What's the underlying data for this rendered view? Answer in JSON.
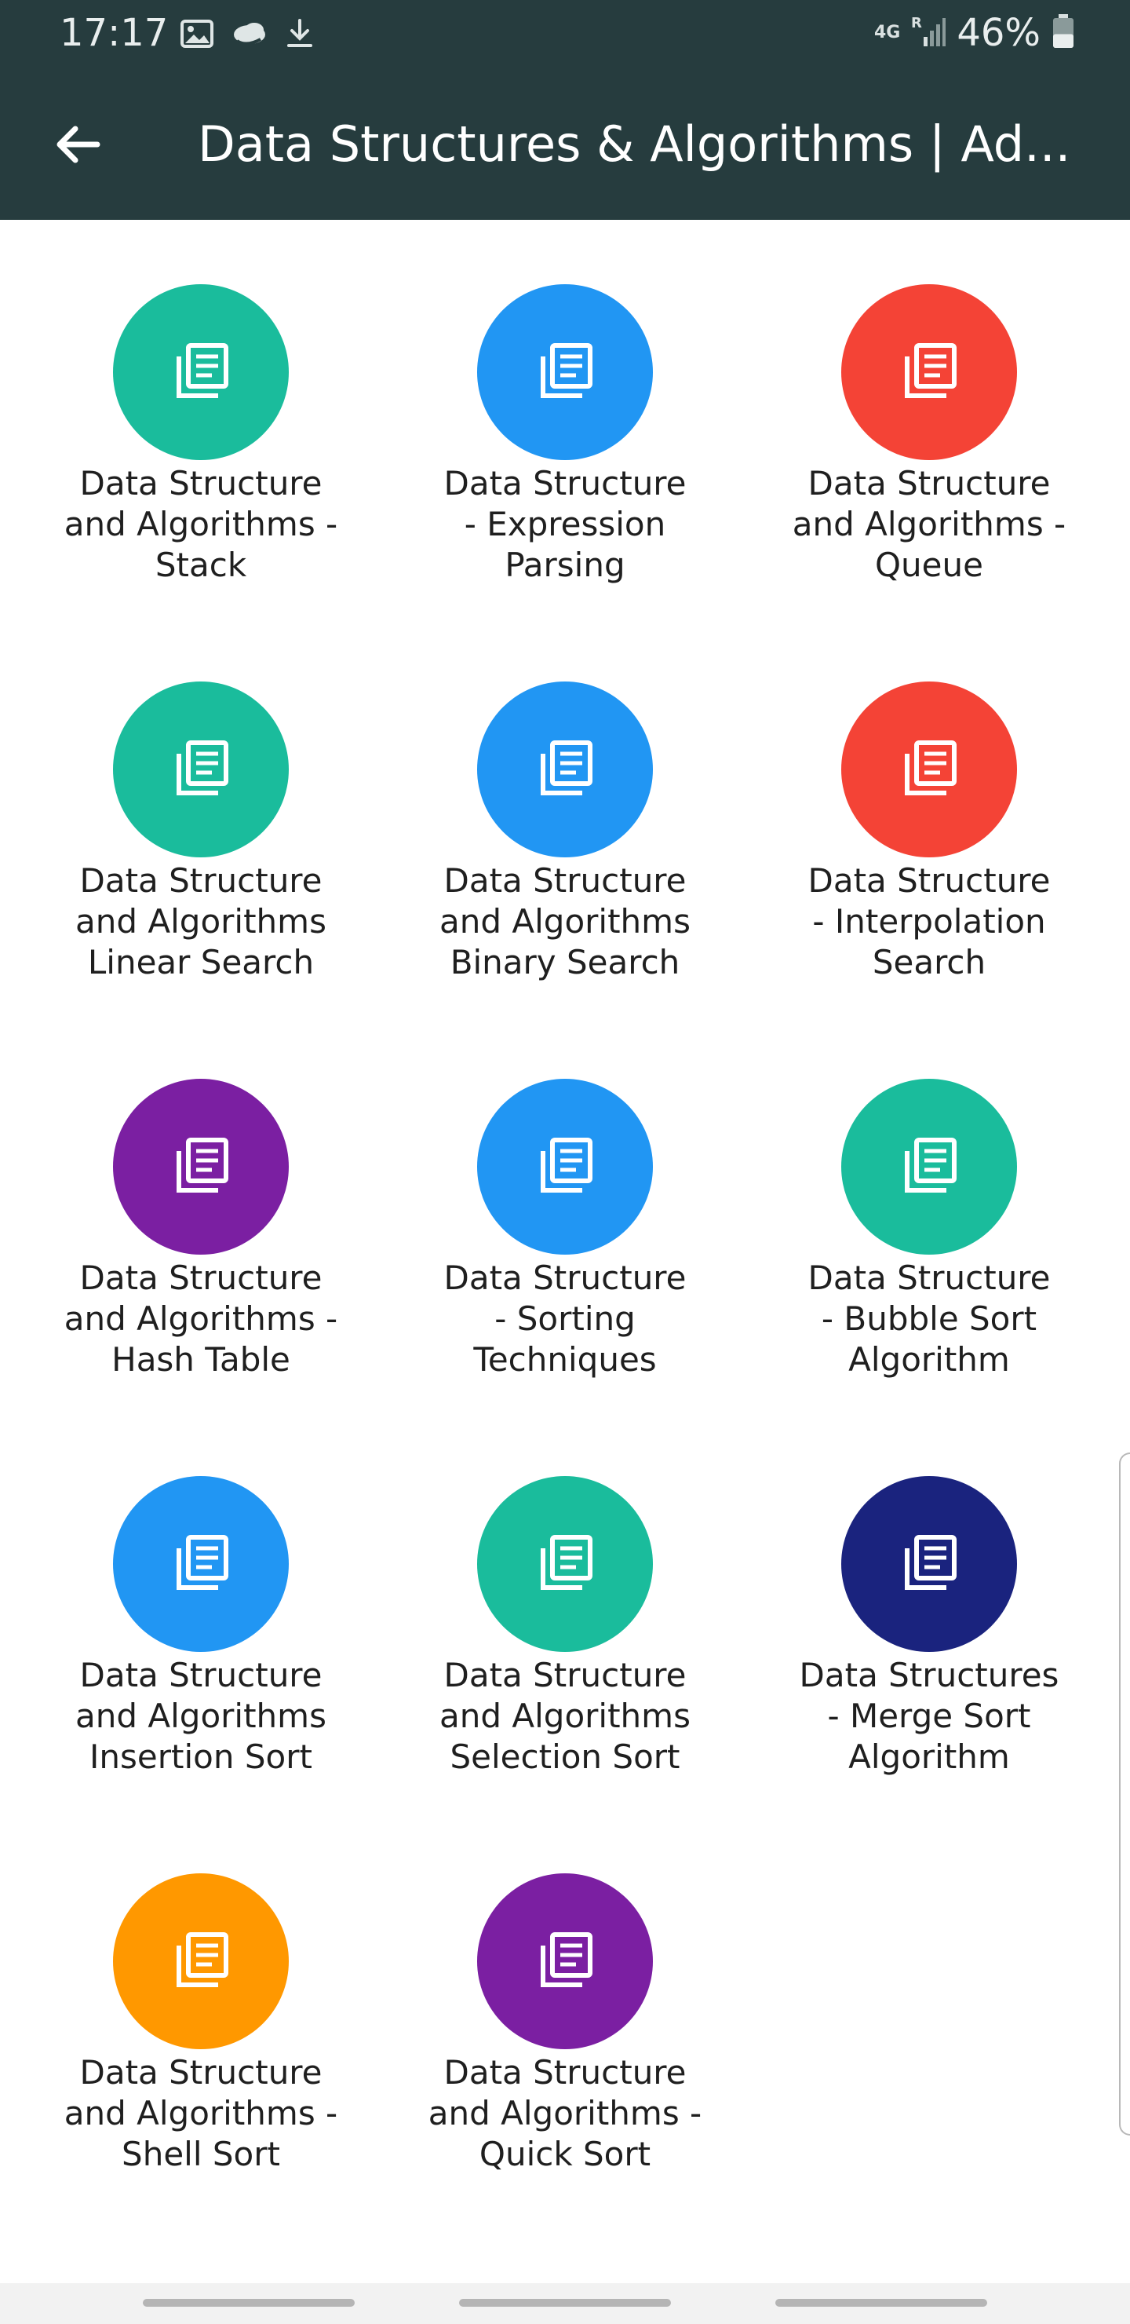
{
  "status_bar": {
    "time": "17:17",
    "left_icons": [
      "image-icon",
      "cloud-icon",
      "download-icon"
    ],
    "network_label": "4G",
    "signal_label": "R",
    "battery_text": "46%",
    "battery_level": 0.46
  },
  "app_bar": {
    "title": "Data Structures & Algorithms | Ad...",
    "back_icon": "back-arrow-icon",
    "background": "#263c3e"
  },
  "tiles": [
    {
      "label": "Data Structure\nand Algorithms -\nStack",
      "color": "#1abc9c",
      "icon": "document-stack-icon"
    },
    {
      "label": "Data Structure\n- Expression\nParsing",
      "color": "#2196f3",
      "icon": "document-stack-icon"
    },
    {
      "label": "Data Structure\nand Algorithms -\nQueue",
      "color": "#f44336",
      "icon": "document-stack-icon"
    },
    {
      "label": "Data Structure\nand Algorithms\nLinear Search",
      "color": "#1abc9c",
      "icon": "document-stack-icon"
    },
    {
      "label": "Data Structure\nand Algorithms\nBinary Search",
      "color": "#2196f3",
      "icon": "document-stack-icon"
    },
    {
      "label": "Data Structure\n- Interpolation\nSearch",
      "color": "#f44336",
      "icon": "document-stack-icon"
    },
    {
      "label": "Data Structure\nand Algorithms -\nHash Table",
      "color": "#7b1fa2",
      "icon": "document-stack-icon"
    },
    {
      "label": "Data Structure\n- Sorting\nTechniques",
      "color": "#2196f3",
      "icon": "document-stack-icon"
    },
    {
      "label": "Data Structure\n- Bubble Sort\nAlgorithm",
      "color": "#1abc9c",
      "icon": "document-stack-icon"
    },
    {
      "label": "Data Structure\nand Algorithms\nInsertion Sort",
      "color": "#2196f3",
      "icon": "document-stack-icon"
    },
    {
      "label": "Data Structure\nand Algorithms\nSelection Sort",
      "color": "#1abc9c",
      "icon": "document-stack-icon"
    },
    {
      "label": "Data Structures\n- Merge Sort\nAlgorithm",
      "color": "#1a237e",
      "icon": "document-stack-icon"
    },
    {
      "label": "Data Structure\nand Algorithms -\nShell Sort",
      "color": "#ff9800",
      "icon": "document-stack-icon"
    },
    {
      "label": "Data Structure\nand Algorithms -\nQuick Sort",
      "color": "#7b1fa2",
      "icon": "document-stack-icon"
    }
  ],
  "nav_bar": {
    "pills": 3
  }
}
